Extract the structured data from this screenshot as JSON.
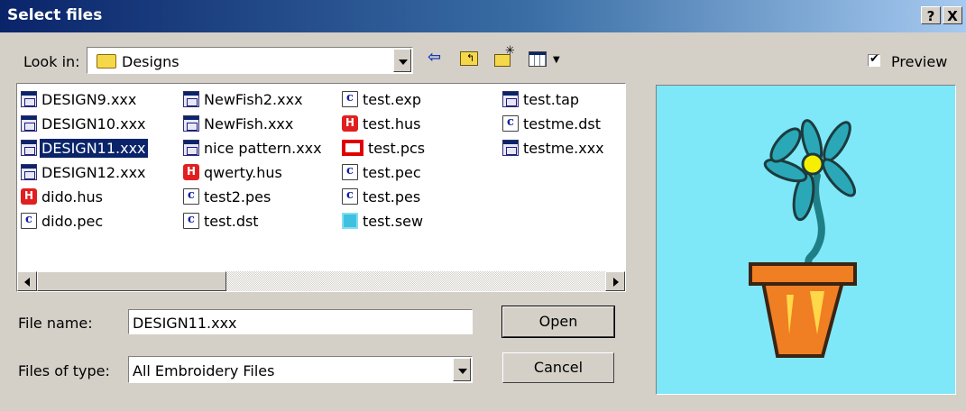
{
  "window": {
    "title": "Select files",
    "help_btn": "?",
    "close_btn": "X"
  },
  "toolbar": {
    "look_in_label": "Look in:",
    "look_in_value": "Designs",
    "back_icon": "back-arrow-icon",
    "up_icon": "up-folder-icon",
    "new_folder_icon": "new-folder-icon",
    "view_menu_icon": "view-menu-icon"
  },
  "preview_option": {
    "label": "Preview",
    "checked": true
  },
  "files": {
    "col1": [
      {
        "name": "DESIGN9.xxx",
        "icon": "design-icon"
      },
      {
        "name": "DESIGN10.xxx",
        "icon": "design-icon"
      },
      {
        "name": "DESIGN11.xxx",
        "icon": "design-icon",
        "selected": true
      },
      {
        "name": "DESIGN12.xxx",
        "icon": "design-icon"
      },
      {
        "name": "dido.hus",
        "icon": "hus-icon"
      },
      {
        "name": "dido.pec",
        "icon": "pec-icon"
      }
    ],
    "col2": [
      {
        "name": "NewFish2.xxx",
        "icon": "design-icon"
      },
      {
        "name": "NewFish.xxx",
        "icon": "design-icon"
      },
      {
        "name": "nice pattern.xxx",
        "icon": "design-icon"
      },
      {
        "name": "qwerty.hus",
        "icon": "hus-icon"
      },
      {
        "name": "test2.pes",
        "icon": "pec-icon"
      },
      {
        "name": "test.dst",
        "icon": "pec-icon"
      }
    ],
    "col3": [
      {
        "name": "test.exp",
        "icon": "pec-icon"
      },
      {
        "name": "test.hus",
        "icon": "hus-icon"
      },
      {
        "name": "test.pcs",
        "icon": "pcs-icon"
      },
      {
        "name": "test.pec",
        "icon": "pec-icon"
      },
      {
        "name": "test.pes",
        "icon": "pec-icon"
      },
      {
        "name": "test.sew",
        "icon": "sew-icon"
      }
    ],
    "col4": [
      {
        "name": "test.tap",
        "icon": "design-icon"
      },
      {
        "name": "testme.dst",
        "icon": "pec-icon"
      },
      {
        "name": "testme.xxx",
        "icon": "design-icon"
      }
    ]
  },
  "form": {
    "filename_label": "File name:",
    "filename_value": "DESIGN11.xxx",
    "filetype_label": "Files of type:",
    "filetype_value": "All Embroidery Files",
    "open_label": "Open",
    "cancel_label": "Cancel"
  },
  "colors": {
    "preview_bg": "#7fe8f8",
    "petal": "#2aa8b8",
    "stem": "#1e7f86",
    "pot": "#f07e22",
    "flower_center": "#f6f000"
  }
}
